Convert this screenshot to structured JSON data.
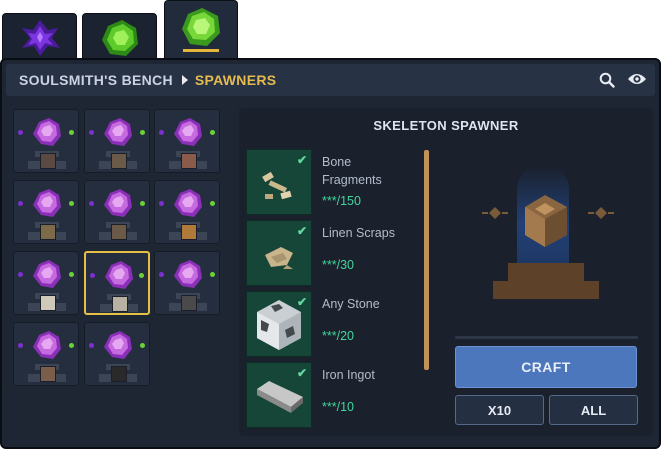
{
  "tabs": [
    {
      "icon": "purple-crystal-icon",
      "color": "#6a2ad0"
    },
    {
      "icon": "green-crystal-icon",
      "color": "#63d12c"
    },
    {
      "icon": "green-crystal-icon",
      "color": "#7ad638",
      "selected": true
    }
  ],
  "header": {
    "crumb_root": "SOULSMITH'S BENCH",
    "crumb_current": "SPAWNERS",
    "search_icon": "search-icon",
    "view_icon": "eye-icon"
  },
  "spawners": [
    {
      "mob": "spider"
    },
    {
      "mob": "zombie"
    },
    {
      "mob": "pig"
    },
    {
      "mob": "creeper"
    },
    {
      "mob": "zombie"
    },
    {
      "mob": "blaze"
    },
    {
      "mob": "skeleton-head"
    },
    {
      "mob": "skeleton",
      "selected": true
    },
    {
      "mob": "cave-spider"
    },
    {
      "mob": "husk"
    },
    {
      "mob": "enderman"
    }
  ],
  "recipe": {
    "title": "SKELETON SPAWNER",
    "ingredients": [
      {
        "name_line1": "Bone",
        "name_line2": "Fragments",
        "count": "***/150",
        "icon": "bone-fragments-icon"
      },
      {
        "name_line1": "Linen Scraps",
        "name_line2": "",
        "count": "***/30",
        "icon": "linen-scraps-icon"
      },
      {
        "name_line1": "Any Stone",
        "name_line2": "",
        "count": "***/20",
        "icon": "stone-block-icon"
      },
      {
        "name_line1": "Iron Ingot",
        "name_line2": "",
        "count": "***/10",
        "icon": "iron-ingot-icon"
      }
    ],
    "craft_label": "CRAFT",
    "x10_label": "X10",
    "all_label": "ALL"
  },
  "colors": {
    "accent": "#e5bb4f",
    "craft": "#4d77bc",
    "count": "#43d69d",
    "slot_gem": "#c66ae0"
  }
}
